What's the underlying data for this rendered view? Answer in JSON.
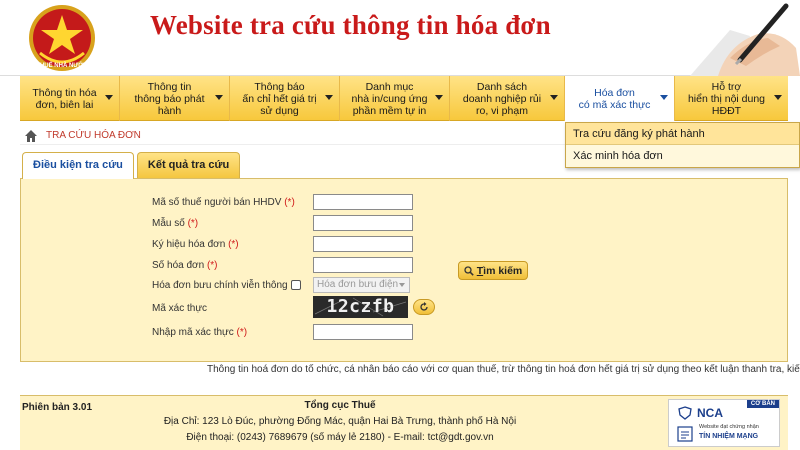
{
  "header": {
    "title": "Website tra cứu thông tin hóa đơn",
    "logo_text": "THUẾ NHÀ NƯỚC"
  },
  "nav": {
    "items": [
      {
        "line1": "Thông tin hóa",
        "line2": "đơn, biên lai",
        "line3": ""
      },
      {
        "line1": "Thông tin",
        "line2": "thông báo phát",
        "line3": "hành"
      },
      {
        "line1": "Thông báo",
        "line2": "ấn chỉ hết giá trị",
        "line3": "sử dụng"
      },
      {
        "line1": "Danh mục",
        "line2": "nhà in/cung ứng",
        "line3": "phần mềm tự in"
      },
      {
        "line1": "Danh sách",
        "line2": "doanh nghiệp rủi",
        "line3": "ro, vi phạm"
      },
      {
        "line1": "Hóa đơn",
        "line2": "có mã xác thực",
        "line3": ""
      },
      {
        "line1": "Hỗ trợ",
        "line2": "hiển thị nội dung",
        "line3": "HĐĐT"
      }
    ],
    "active_index": 5
  },
  "dropdown": {
    "items": [
      "Tra cứu đăng ký phát hành",
      "Xác minh hóa đơn"
    ]
  },
  "breadcrumb": {
    "current": "TRA CỨU HÓA ĐƠN"
  },
  "tabs": {
    "conditions": "Điều kiện tra cứu",
    "results": "Kết quả tra cứu"
  },
  "form": {
    "tax_code_label": "Mã số thuế người bán HHDV",
    "template_label": "Mẫu số",
    "series_label": "Ký hiệu hóa đơn",
    "number_label": "Số hóa đơn",
    "postal_label": "Hóa đơn bưu chính viễn thông",
    "postal_select": "Hóa đơn bưu điện",
    "captcha_label": "Mã xác thực",
    "captcha_value": "12czfb",
    "captcha_input_label": "Nhập mã xác thực",
    "required_mark": "(*)",
    "search_button_first": "T",
    "search_button_rest": "ìm kiếm"
  },
  "notice": "Thông tin hoá đơn do tổ chức, cá nhân báo cáo với cơ quan thuế, trừ thông tin hoá đơn hết giá trị sử dụng theo kết luận thanh tra, kiểm tra",
  "footer": {
    "version": "Phiên bản 3.01",
    "org": "Tổng cục Thuế",
    "address": "Địa Chỉ: 123 Lò Đúc, phường Đống Mác, quận Hai Bà Trưng, thành phố Hà Nội",
    "contact": "Điện thoại: (0243) 7689679 (số máy lẻ 2180) - E-mail: tct@gdt.gov.vn",
    "nca_badge": "CƠ BẢN",
    "nca_logo": "NCA",
    "nca_sub": "Website đạt chứng nhận",
    "nca_main": "TÍN NHIỆM MẠNG"
  },
  "colors": {
    "accent_yellow": "#f7c83c",
    "title_red": "#c91a1a",
    "link_blue": "#1a4fa0",
    "panel_bg": "#fff3c6"
  }
}
